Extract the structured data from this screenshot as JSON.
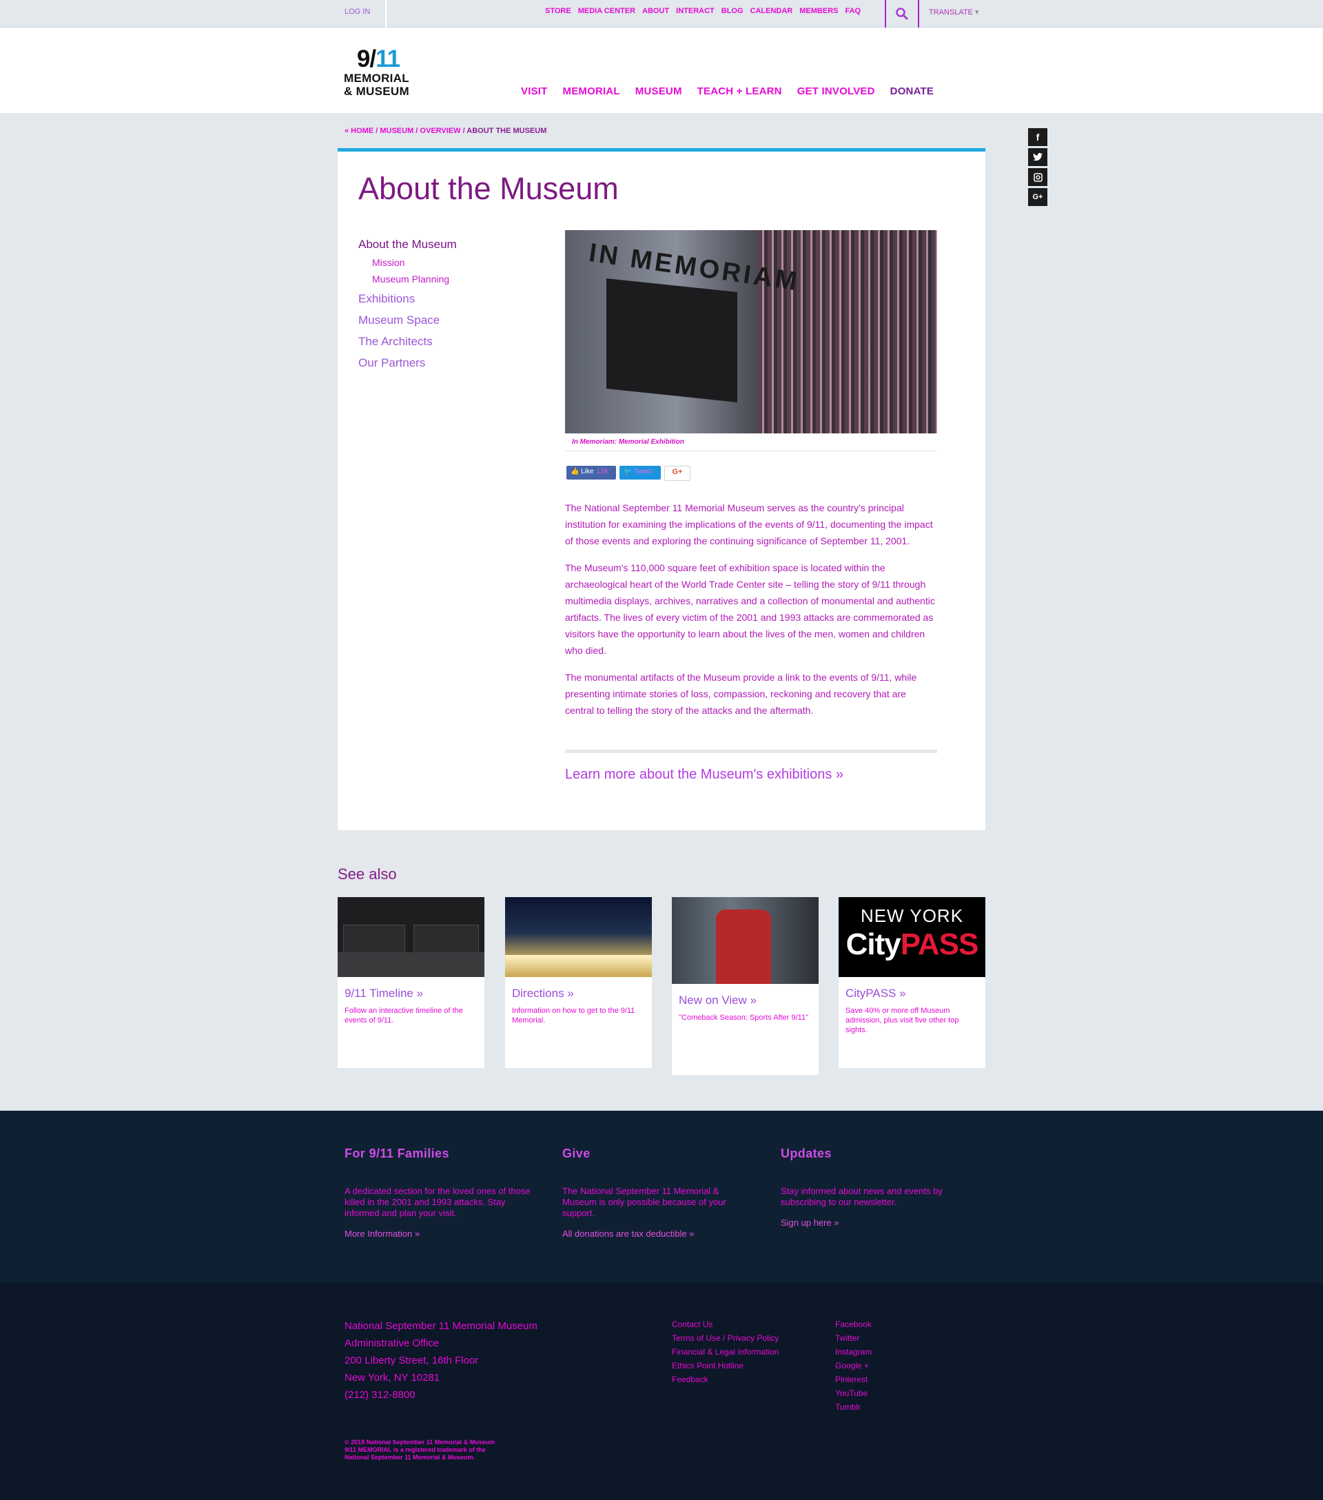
{
  "topbar": {
    "login": "LOG IN",
    "utility_nav": [
      "STORE",
      "MEDIA CENTER",
      "ABOUT",
      "INTERACT",
      "BLOG",
      "CALENDAR",
      "MEMBERS",
      "FAQ"
    ],
    "translate": "TRANSLATE",
    "translate_caret": "▾"
  },
  "logo": {
    "num_nine": "9",
    "num_slash": "/",
    "num_eleven": "11",
    "line1": "MEMORIAL",
    "line2": "& MUSEUM"
  },
  "main_nav": [
    "VISIT",
    "MEMORIAL",
    "MUSEUM",
    "TEACH + LEARN",
    "GET INVOLVED",
    "DONATE"
  ],
  "breadcrumb": {
    "home": "« HOME",
    "sep": " / ",
    "museum": "MUSEUM",
    "overview": "OVERVIEW",
    "current": "ABOUT THE MUSEUM"
  },
  "social_side": [
    "f",
    "t",
    "ig",
    "G+"
  ],
  "page": {
    "title": "About the Museum",
    "subnav": {
      "top": "About the Museum",
      "subs": [
        "Mission",
        "Museum Planning"
      ],
      "items": [
        "Exhibitions",
        "Museum Space",
        "The Architects",
        "Our Partners"
      ]
    },
    "hero_text": "IN MEMORIAM",
    "caption": "In Memoriam: Memorial Exhibition",
    "share": {
      "fb_label": "Like",
      "fb_count": "12K",
      "tw_label": "Tweet",
      "gp_label": "G+"
    },
    "paragraphs": [
      "The National September 11 Memorial Museum serves as the country's principal institution for examining the implications of the events of 9/11, documenting the impact of those events and exploring the continuing significance of September 11, 2001.",
      "The Museum's 110,000 square feet of exhibition space is located within the archaeological heart of the World Trade Center site – telling the story of 9/11 through multimedia displays, archives, narratives and a collection of monumental and authentic artifacts. The lives of every victim of the 2001 and 1993 attacks are commemorated as visitors have the opportunity to learn about the lives of the men, women and children who died.",
      "The monumental artifacts of the Museum provide a link to the events of 9/11, while presenting intimate stories of loss, compassion, reckoning and recovery that are central to telling the story of the attacks and the aftermath."
    ],
    "learn_more": "Learn more about the Museum's exhibitions »"
  },
  "see_also": {
    "title": "See also",
    "tiles": [
      {
        "title": "9/11 Timeline »",
        "desc": "Follow an interactive timeline of the events of 9/11."
      },
      {
        "title": "Directions »",
        "desc": "Information on how to get to the 9/11 Memorial."
      },
      {
        "title": "New on View »",
        "desc": "\"Comeback Season: Sports After 9/11\""
      },
      {
        "title": "CityPASS »",
        "desc": "Save 40% or more off Museum admission, plus visit five other top sights."
      }
    ],
    "citypass_ny": "NEW YORK",
    "citypass_city": "City",
    "citypass_pass": "PASS"
  },
  "footer_top": {
    "families": {
      "title": "For 9/11 Families",
      "text": "A dedicated section for the loved ones of those killed in the 2001 and 1993 attacks. Stay informed and plan your visit.",
      "link": "More Information »"
    },
    "give": {
      "title": "Give",
      "text": "The National September 11 Memorial & Museum is only possible because of your support.",
      "link": "All donations are tax deductible »"
    },
    "updates": {
      "title": "Updates",
      "text": "Stay informed about news and events by subscribing to our newsletter.",
      "link": "Sign up here »"
    }
  },
  "footer_bottom": {
    "address": [
      "National September 11 Memorial Museum",
      "Administrative Office",
      "200 Liberty Street, 16th Floor",
      "New York, NY 10281",
      "(212) 312-8800"
    ],
    "links_a": [
      "Contact Us",
      "Terms of Use / Privacy Policy",
      "Financial & Legal Information",
      "Ethics Point Hotline",
      "Feedback"
    ],
    "links_b": [
      "Facebook",
      "Twitter",
      "Instagram",
      "Google +",
      "Pinterest",
      "YouTube",
      "Tumblr"
    ],
    "copyright": [
      "© 2018 National September 11 Memorial & Museum",
      "9/11 MEMORIAL is a registered trademark of the",
      "National September 11 Memorial & Museum."
    ]
  }
}
